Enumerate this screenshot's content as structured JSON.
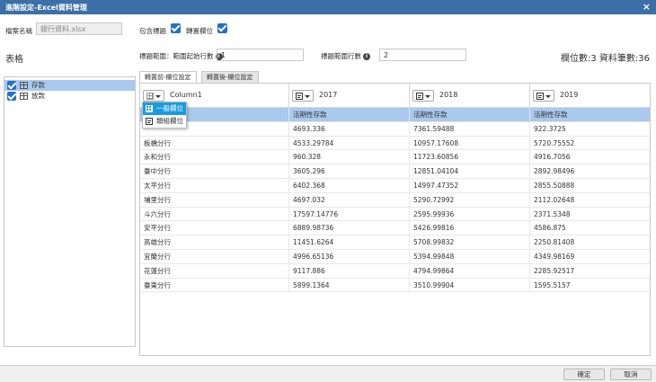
{
  "window": {
    "title": "進階設定-Excel資料管理",
    "close": "×"
  },
  "form": {
    "filename_label": "檔案名稱",
    "filename_value": "銀行資料.xlsx",
    "include_header_label": "包含標題",
    "transpose_label": "轉置欄位",
    "header_range_label": "標題範圍：範圍起始行數",
    "header_range_value": "1",
    "header_range_rows_label": "標題範圍行數",
    "header_range_rows_value": "2",
    "summary": "欄位數:3 資料筆數:36"
  },
  "left": {
    "title": "表格",
    "items": [
      {
        "label": "存款",
        "checked": true,
        "selected": true
      },
      {
        "label": "放款",
        "checked": true,
        "selected": false
      }
    ]
  },
  "tabs": [
    {
      "label": "轉置前-欄位設定",
      "active": true
    },
    {
      "label": "轉置後-欄位設定",
      "active": false
    }
  ],
  "grid": {
    "columns": [
      {
        "name": "Column1",
        "type_icon": "grid-icon"
      },
      {
        "name": "2017",
        "type_icon": "number-icon"
      },
      {
        "name": "2018",
        "type_icon": "number-icon"
      },
      {
        "name": "2019",
        "type_icon": "number-icon"
      }
    ],
    "type_row": [
      "",
      "活期性存款",
      "活期性存款",
      "活期性存款"
    ],
    "rows": [
      [
        "",
        "4693.336",
        "7361.59488",
        "922.3725"
      ],
      [
        "板橋分行",
        "4533.29784",
        "10957.17608",
        "5720.75552"
      ],
      [
        "永和分行",
        "960.328",
        "11723.60856",
        "4916.7056"
      ],
      [
        "臺中分行",
        "3605.296",
        "12851.04104",
        "2892.98496"
      ],
      [
        "太平分行",
        "6402.368",
        "14997.47352",
        "2855.50888"
      ],
      [
        "埔里分行",
        "4697.032",
        "5290.72992",
        "2112.02648"
      ],
      [
        "斗六分行",
        "17597.14776",
        "2595.99936",
        "2371.5348"
      ],
      [
        "安平分行",
        "6889.98736",
        "5426.99816",
        "4586.875"
      ],
      [
        "高雄分行",
        "11451.6264",
        "5708.99832",
        "2250.81408"
      ],
      [
        "宜蘭分行",
        "4996.65136",
        "5394.99848",
        "4349.98169"
      ],
      [
        "花蓮分行",
        "9117.886",
        "4794.99864",
        "2285.92517"
      ],
      [
        "臺東分行",
        "5899.1364",
        "3510.99904",
        "1595.5157"
      ]
    ]
  },
  "dropdown": {
    "items": [
      {
        "label": "一般欄位",
        "selected": true
      },
      {
        "label": "類組欄位",
        "selected": false
      }
    ]
  },
  "footer": {
    "ok": "確定",
    "cancel": "取消"
  }
}
